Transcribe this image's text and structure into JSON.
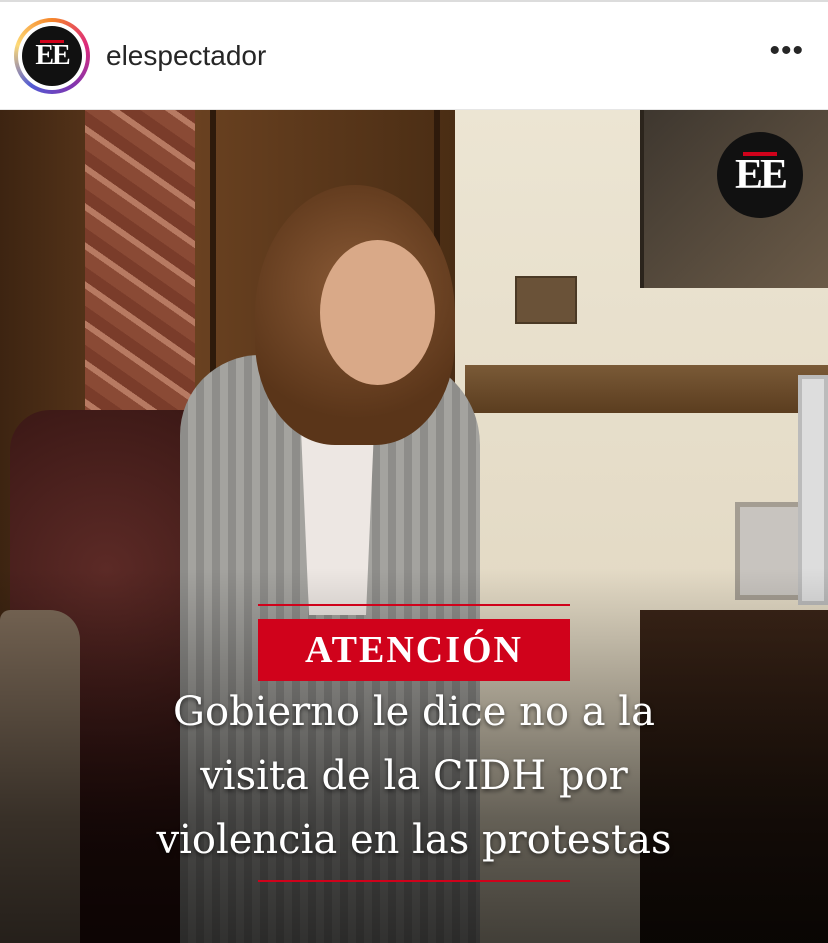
{
  "post": {
    "username": "elespectador",
    "avatar_text": "EE",
    "more_icon": "more-horizontal-icon"
  },
  "media": {
    "logo_text": "EE",
    "tag": "ATENCIÓN",
    "headline_lines": [
      "Gobierno le dice no a la",
      "visita de la CIDH por",
      "violencia en las protestas"
    ]
  },
  "colors": {
    "accent_red": "#d0021b",
    "text_dark": "#262626"
  }
}
